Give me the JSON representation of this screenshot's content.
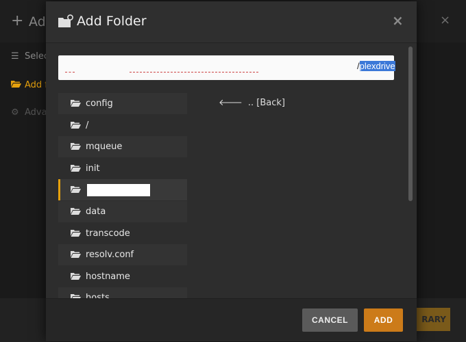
{
  "background": {
    "title": "Add",
    "nav": [
      {
        "label": "Selec",
        "icon": "list-icon",
        "color": "#8a8a8a"
      },
      {
        "label": "Add f",
        "icon": "folder-icon",
        "color": "#e5a00d"
      },
      {
        "label": "Adva",
        "icon": "gear-icon",
        "color": "#555555"
      }
    ],
    "footer_button": "RARY"
  },
  "modal": {
    "title": "Add Folder",
    "close_symbol": "×",
    "path": {
      "value": "",
      "selected_tail": "plexdrive",
      "prefix_char": "/"
    },
    "folders": [
      {
        "label": "config"
      },
      {
        "label": "/"
      },
      {
        "label": "mqueue"
      },
      {
        "label": "init"
      },
      {
        "label": "",
        "selected": true,
        "redacted": true
      },
      {
        "label": "data"
      },
      {
        "label": "transcode"
      },
      {
        "label": "resolv.conf"
      },
      {
        "label": "hostname"
      },
      {
        "label": "hosts"
      }
    ],
    "back_label": ".. [Back]",
    "buttons": {
      "cancel": "CANCEL",
      "add": "ADD"
    }
  },
  "colors": {
    "accent": "#e5a00d",
    "add_button": "#cc7b19",
    "cancel_button": "#5a5a5a",
    "selection": "#3b78d8"
  }
}
